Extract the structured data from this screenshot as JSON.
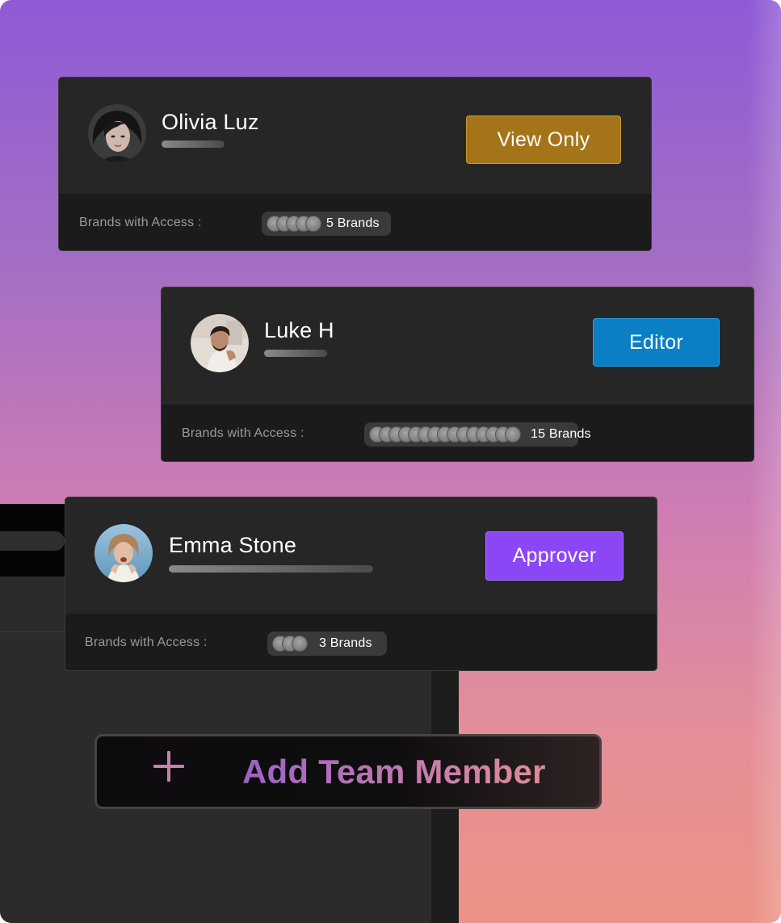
{
  "access_label": "Brands with Access :",
  "members": [
    {
      "name": "Olivia Luz",
      "role": "View Only",
      "role_color": "#a47418",
      "brand_count": 5,
      "brands_label": "5 Brands"
    },
    {
      "name": "Luke H",
      "role": "Editor",
      "role_color": "#0a7fc5",
      "brand_count": 15,
      "brands_label": "15 Brands"
    },
    {
      "name": "Emma Stone",
      "role": "Approver",
      "role_color": "#8b47f5",
      "brand_count": 3,
      "brands_label": "3 Brands"
    }
  ],
  "add_button": {
    "label": "Add Team Member",
    "icon": "plus-icon"
  },
  "colors": {
    "card_bg": "#262626",
    "card_footer_bg": "#1b1b1b",
    "gradient_top": "#8f5ad6",
    "gradient_bottom": "#ec9284"
  }
}
